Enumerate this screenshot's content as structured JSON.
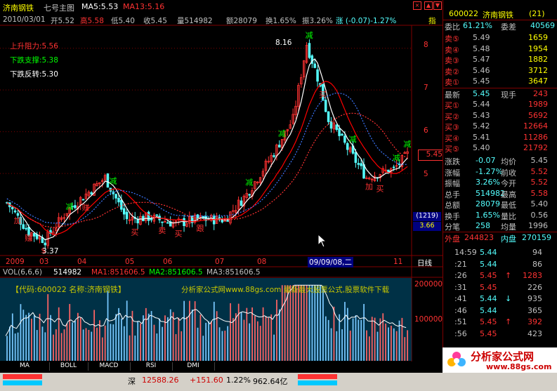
{
  "toolbar": {
    "stock_name": "济南钢铁",
    "formula": "七号主图",
    "ma5": "MA5:5.53",
    "ma13": "MA13:5.16"
  },
  "info": {
    "date": "2010/03/01",
    "open": "开5.52",
    "high": "高5.58",
    "low": "低5.40",
    "close": "收5.45",
    "volume": "量514982",
    "amount": "额28079",
    "turnover": "换1.65%",
    "amplitude": "振3.26%",
    "change": "涨 (-0.07)-1.27%",
    "index_label": "指"
  },
  "chart_data": {
    "type": "candlestick",
    "price_axis": [
      8.0,
      7.0,
      6.0,
      5.0
    ],
    "price_ylim": [
      3.05,
      8.55
    ],
    "volume_axis": [
      "200000",
      "100000"
    ],
    "volume_ylim": [
      0,
      230000
    ],
    "time_labels": [
      "2009",
      "03",
      "04",
      "05",
      "06",
      "07",
      "08",
      "09/09/08,二",
      "11"
    ],
    "cursor_label": "5.45",
    "high_mark": "8.16",
    "low_mark": "3.37",
    "price_box_top": "(1219)",
    "price_box_bottom": "3.66",
    "annotations": {
      "upper_resist": "上升阻力:5.56",
      "lower_support": "下跌支撑:5.38",
      "lower_reverse": "下跌反转:5.30"
    },
    "signals": [
      "减",
      "加",
      "买",
      "卖",
      "跟",
      "赚",
      "$"
    ],
    "volume_indicator": {
      "name": "VOL(6,6,6)",
      "value": "514982",
      "ma1": "MA1:851606.5",
      "ma2": "MA2:851606.5",
      "ma3": "MA3:851606.5"
    },
    "watermark_left": "【代码:600022 名称:济南钢铁】",
    "watermark_right": "分析家公式网www.88gs.com 最新最大股票公式,股票软件下载"
  },
  "period_tab": "日线",
  "bottom_tabs": [
    "MA",
    "BOLL",
    "MACD",
    "RSI",
    "DMI"
  ],
  "quote": {
    "code": "600022",
    "name": "济南钢铁",
    "count": "(21)",
    "weibi_label": "委比",
    "weibi_value": "61.21%",
    "weicha_label": "委差",
    "weicha_value": "40569",
    "sell": [
      {
        "label": "卖⑤",
        "price": "5.49",
        "vol": "1659"
      },
      {
        "label": "卖④",
        "price": "5.48",
        "vol": "1954"
      },
      {
        "label": "卖③",
        "price": "5.47",
        "vol": "1882"
      },
      {
        "label": "卖②",
        "price": "5.46",
        "vol": "3712"
      },
      {
        "label": "卖①",
        "price": "5.45",
        "vol": "3647"
      }
    ],
    "last_label": "最新",
    "last_price": "5.45",
    "hand_label": "现手",
    "hand_value": "243",
    "buy": [
      {
        "label": "买①",
        "price": "5.44",
        "vol": "1989"
      },
      {
        "label": "买②",
        "price": "5.43",
        "vol": "5692"
      },
      {
        "label": "买③",
        "price": "5.42",
        "vol": "12664"
      },
      {
        "label": "买④",
        "price": "5.41",
        "vol": "11286"
      },
      {
        "label": "买⑤",
        "price": "5.40",
        "vol": "21792"
      }
    ],
    "stats": [
      {
        "l1": "涨跌",
        "v1": "-0.07",
        "l2": "均价",
        "v2": "5.45"
      },
      {
        "l1": "涨幅",
        "v1": "-1.27%",
        "l2": "前收",
        "v2": "5.52"
      },
      {
        "l1": "振幅",
        "v1": "3.26%",
        "l2": "今开",
        "v2": "5.52"
      },
      {
        "l1": "总手",
        "v1": "514982",
        "l2": "最高",
        "v2": "5.58"
      },
      {
        "l1": "总额",
        "v1": "28079",
        "l2": "最低",
        "v2": "5.40"
      },
      {
        "l1": "换手",
        "v1": "1.65%",
        "l2": "量比",
        "v2": "0.56"
      },
      {
        "l1": "分笔",
        "v1": "258",
        "l2": "均量",
        "v2": "1996"
      }
    ],
    "outer_label": "外盘",
    "outer_value": "244823",
    "inner_label": "内盘",
    "inner_value": "270159",
    "ticks": [
      {
        "time": "14:59",
        "price": "5.44",
        "arrow": "",
        "vol": "94"
      },
      {
        "time": ":21",
        "price": "5.44",
        "arrow": "",
        "vol": "86"
      },
      {
        "time": ":26",
        "price": "5.45",
        "arrow": "↑",
        "vol": "1283"
      },
      {
        "time": ":31",
        "price": "5.45",
        "arrow": "",
        "vol": "226"
      },
      {
        "time": ":41",
        "price": "5.44",
        "arrow": "↓",
        "vol": "935"
      },
      {
        "time": ":46",
        "price": "5.44",
        "arrow": "",
        "vol": "365"
      },
      {
        "time": ":51",
        "price": "5.45",
        "arrow": "↑",
        "vol": "392"
      },
      {
        "time": ":56",
        "price": "5.45",
        "arrow": "",
        "vol": "423"
      }
    ]
  },
  "status": {
    "index_name": "深",
    "index_value": "12588.26",
    "index_change": "+151.60",
    "index_pct": "1.22%",
    "index_amount": "962.64亿"
  },
  "logo": {
    "text": "分析家公式网",
    "url": "www.88gs.com"
  },
  "colors": {
    "up": "#ff3232",
    "down": "#54ffff",
    "ma_white": "#ffffff",
    "ma_red": "#ff0000",
    "text_yellow": "#ffff00",
    "text_green": "#00ff00",
    "quote_yellow": "#ffff00"
  }
}
